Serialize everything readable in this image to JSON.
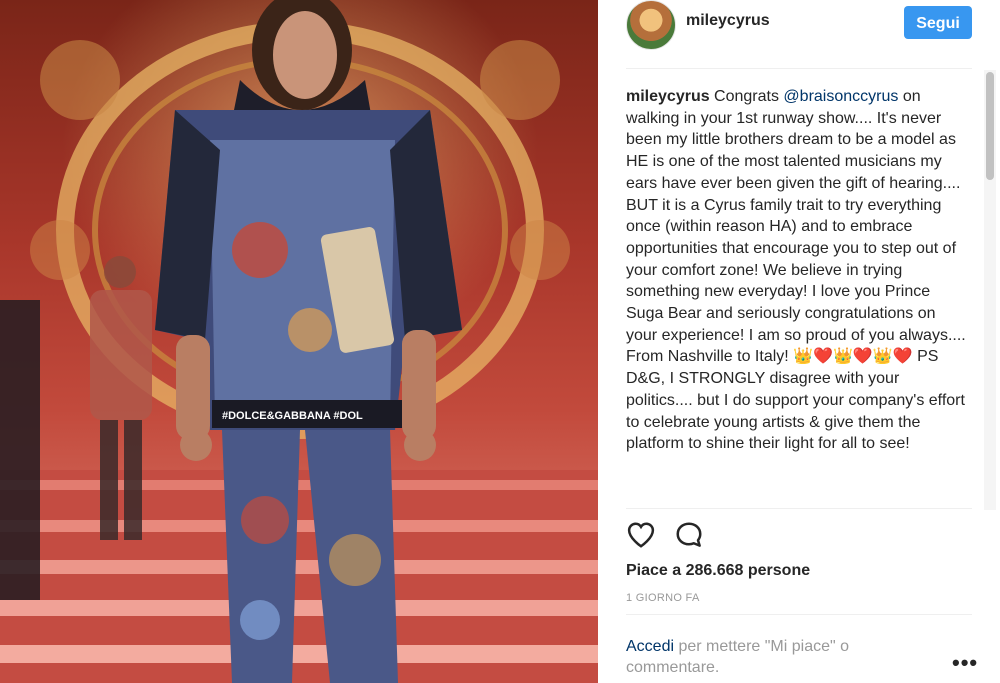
{
  "post": {
    "username": "mileycyrus",
    "follow_label": "Segui",
    "caption": {
      "user": "mileycyrus",
      "text_before": " Congrats ",
      "mention": "@braisonccyrus",
      "text_after": " on walking in your 1st runway show.... It's never been my little brothers dream to be a model as HE is one of the most talented musicians my ears have ever been given the gift of hearing.... BUT it is a Cyrus family trait to try everything once (within reason HA) and to embrace opportunities that encourage you to step out of your comfort zone! We believe in trying something new everyday! I love you Prince Suga Bear and seriously congratulations on your experience! I am so proud of you always.... From Nashville to Italy! ",
      "emoji_1": "👑",
      "emoji_2": "❤️",
      "emoji_3": "👑",
      "emoji_4": "❤️",
      "emoji_5": "👑",
      "emoji_6": "❤️",
      "text_end": " PS D&G, I STRONGLY disagree with your politics.... but I do support your company's effort to celebrate young artists & give them the platform to shine their light for all to see!"
    },
    "likes": "Piace a 286.668 persone",
    "timestamp": "1 GIORNO FA",
    "login": {
      "link": "Accedi",
      "text": " per mettere \"Mi piace\" o commentare."
    },
    "more_label": "•••"
  },
  "photo": {
    "shirt_text": "#DOLCE&GABBANA #DOL"
  },
  "icons": {
    "avatar": "profile-avatar",
    "like": "heart-outline-icon",
    "comment": "speech-bubble-icon",
    "more": "ellipsis-icon"
  },
  "colors": {
    "accent": "#3897f0",
    "link": "#003569",
    "muted": "#999999"
  }
}
